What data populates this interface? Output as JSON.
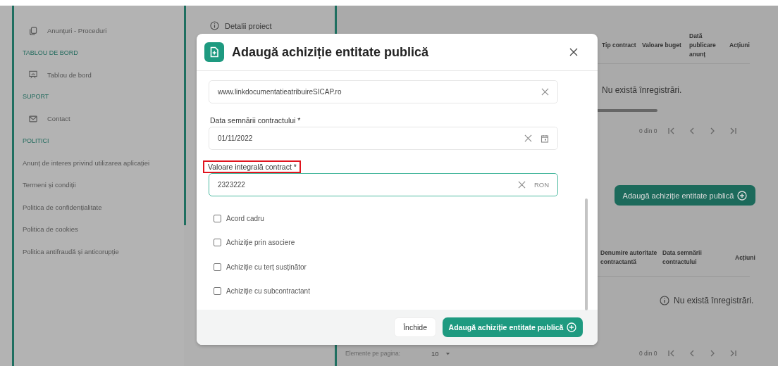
{
  "sidebar": {
    "items": [
      {
        "kind": "icon-link",
        "label": "Anunțuri - Proceduri"
      },
      {
        "kind": "heading",
        "label": "TABLOU DE BORD"
      },
      {
        "kind": "icon-link",
        "label": "Tablou de bord"
      },
      {
        "kind": "heading",
        "label": "SUPORT"
      },
      {
        "kind": "icon-link",
        "label": "Contact"
      },
      {
        "kind": "heading",
        "label": "POLITICI"
      },
      {
        "kind": "link",
        "label": "Anunț de interes privind utilizarea aplicației"
      },
      {
        "kind": "link",
        "label": "Termeni și condiții"
      },
      {
        "kind": "link",
        "label": "Politica de confidențialitate"
      },
      {
        "kind": "link",
        "label": "Politica de cookies"
      },
      {
        "kind": "link",
        "label": "Politica antifraudă și anticorupție"
      }
    ]
  },
  "project_tab": {
    "label": "Detalii proiect"
  },
  "announcements_table": {
    "columns": [
      "Tip contract",
      "Valoare buget",
      "Dată publicare anunț",
      "Acțiuni"
    ],
    "empty_message": "Nu există înregistrări.",
    "pagination": "0 din 0"
  },
  "add_button": "Adaugă achiziție entitate publică",
  "acquisitions_table": {
    "columns": [
      "Denumire autoritate contractantă",
      "Data semnării contractului",
      "Acțiuni"
    ],
    "empty_message": "Nu există înregistrări.",
    "per_page_label": "Elemente pe pagina:",
    "per_page_value": "10",
    "pagination": "0 din 0"
  },
  "modal": {
    "title": "Adaugă achiziție entitate publică",
    "fields": [
      {
        "kind": "text",
        "value": "www.linkdocumentatieatribuireSICAP.ro",
        "focused": false
      },
      {
        "kind": "date",
        "label": "Data semnării contractului *",
        "value": "01/11/2022",
        "focused": false
      },
      {
        "kind": "amount",
        "label": "Valoare integrală contract *",
        "value": "2323222",
        "suffix": "RON",
        "highlighted": true,
        "focused": true
      }
    ],
    "checkboxes": [
      {
        "label": "Acord cadru",
        "checked": false
      },
      {
        "label": "Achiziție prin asociere",
        "checked": false
      },
      {
        "label": "Achiziție cu terț susținător",
        "checked": false
      },
      {
        "label": "Achiziție cu subcontractant",
        "checked": false
      }
    ],
    "close_button": "Închide",
    "submit_button": "Adaugă achiziție entitate publică"
  }
}
